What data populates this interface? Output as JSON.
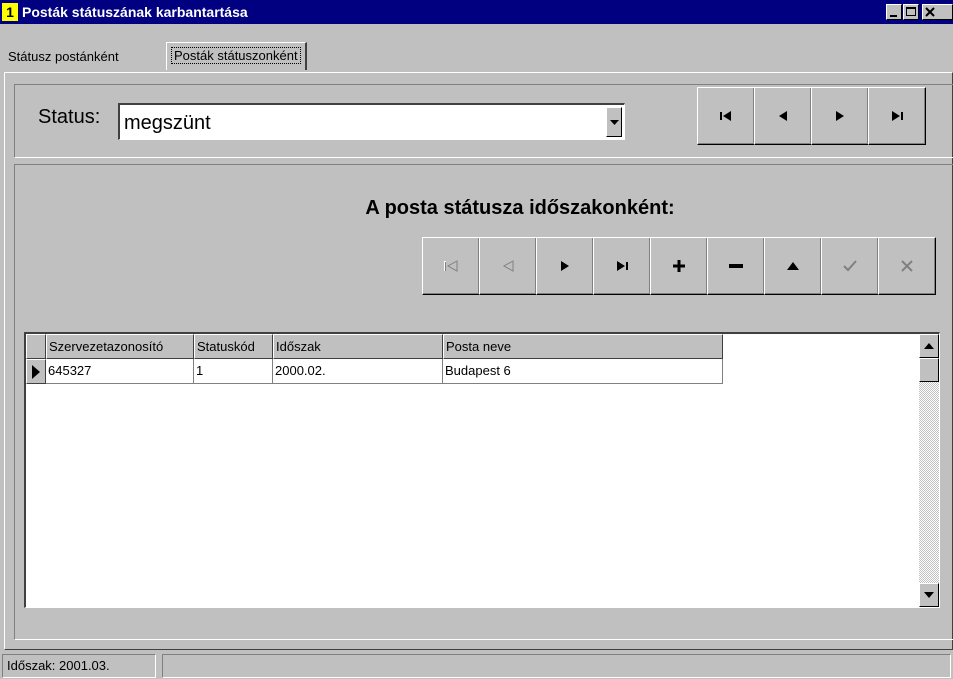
{
  "window": {
    "badge": "1",
    "title": "Posták státuszának karbantartása"
  },
  "tabs": [
    {
      "label": "Státusz postánként",
      "active": false
    },
    {
      "label": "Posták státuszonként",
      "active": true
    }
  ],
  "filter": {
    "label": "Status:",
    "value": "megszünt"
  },
  "record_nav": {
    "buttons": [
      "first-icon",
      "prior-icon",
      "next-icon",
      "last-icon"
    ]
  },
  "section": {
    "title": "A posta státusza időszakonként:"
  },
  "db_nav": {
    "buttons": [
      {
        "name": "first",
        "icon": "first-icon",
        "enabled": false
      },
      {
        "name": "prior",
        "icon": "prior-icon",
        "enabled": false
      },
      {
        "name": "next",
        "icon": "next-icon",
        "enabled": true
      },
      {
        "name": "last",
        "icon": "last-icon",
        "enabled": true
      },
      {
        "name": "insert",
        "icon": "plus-icon",
        "enabled": true
      },
      {
        "name": "delete",
        "icon": "minus-icon",
        "enabled": true
      },
      {
        "name": "edit",
        "icon": "up-triangle-icon",
        "enabled": true
      },
      {
        "name": "post",
        "icon": "checkmark-icon",
        "enabled": false
      },
      {
        "name": "cancel",
        "icon": "x-icon",
        "enabled": false
      }
    ]
  },
  "grid": {
    "columns": [
      "Szervezetazonosító",
      "Statuskód",
      "Időszak",
      "Posta neve"
    ],
    "rows": [
      [
        "645327",
        "1",
        "2000.02.",
        "Budapest 6"
      ]
    ]
  },
  "statusbar": {
    "period": "Időszak: 2001.03.",
    "extra": ""
  },
  "colors": {
    "titlebar": "#000080",
    "face": "#c0c0c0",
    "badge": "#ffff00"
  }
}
